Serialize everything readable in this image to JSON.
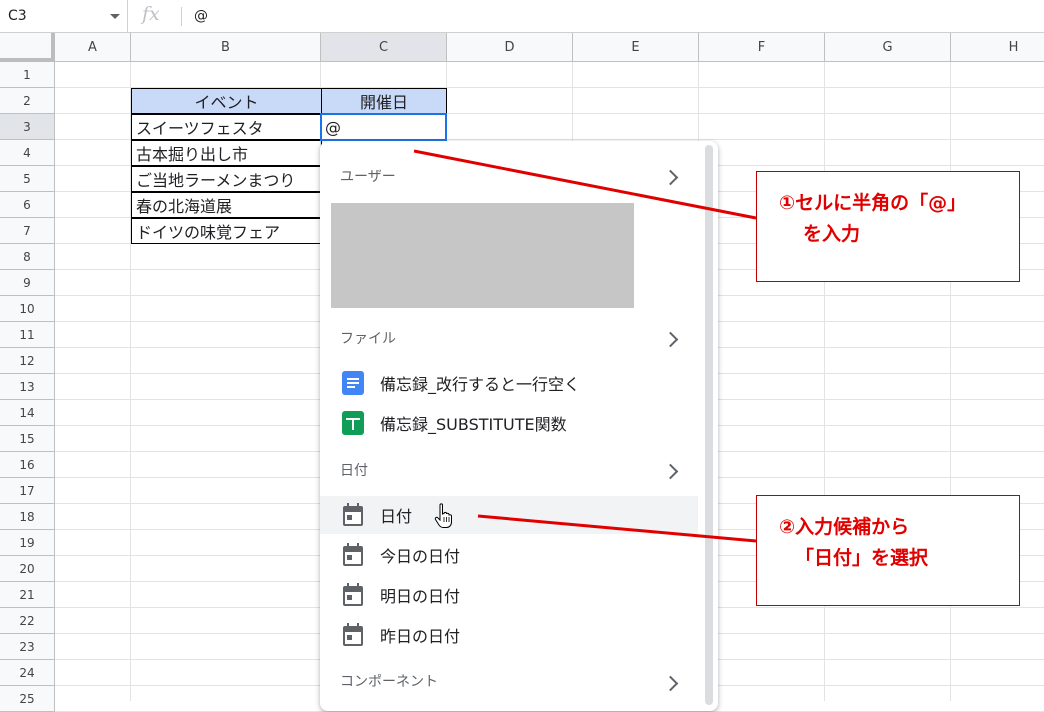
{
  "formula_bar": {
    "name_box": "C3",
    "fx_label": "fx",
    "value": "@"
  },
  "columns": [
    "A",
    "B",
    "C",
    "D",
    "E",
    "F",
    "G",
    "H"
  ],
  "rows": [
    "1",
    "2",
    "3",
    "4",
    "5",
    "6",
    "7",
    "8",
    "9",
    "10",
    "11",
    "12",
    "13",
    "14",
    "15",
    "16",
    "17",
    "18",
    "19",
    "20",
    "21",
    "22",
    "23",
    "24",
    "25"
  ],
  "table": {
    "headers": [
      "イベント",
      "開催日"
    ],
    "events": [
      "スイーツフェスタ",
      "古本掘り出し市",
      "ご当地ラーメンまつり",
      "春の北海道展",
      "ドイツの味覚フェア"
    ],
    "active_cell_value": "@"
  },
  "dropdown": {
    "sections": {
      "users": "ユーザー",
      "files": "ファイル",
      "dates": "日付",
      "components": "コンポーネント"
    },
    "files": [
      {
        "label": "備忘録_改行すると一行空く",
        "icon": "google-docs-icon"
      },
      {
        "label": "備忘録_SUBSTITUTE関数",
        "icon": "google-sheets-icon"
      }
    ],
    "dates": [
      {
        "label": "日付",
        "icon": "calendar-icon"
      },
      {
        "label": "今日の日付",
        "icon": "calendar-icon"
      },
      {
        "label": "明日の日付",
        "icon": "calendar-icon"
      },
      {
        "label": "昨日の日付",
        "icon": "calendar-icon"
      }
    ]
  },
  "annotations": {
    "callout1": {
      "line1": "①セルに半角の「@」",
      "line2": "を入力"
    },
    "callout2": {
      "line1": "②入力候補から",
      "line2": "「日付」を選択"
    },
    "color": "#e00000"
  },
  "colors": {
    "header_fill": "#c9daf8",
    "selection": "#1a73e8"
  }
}
